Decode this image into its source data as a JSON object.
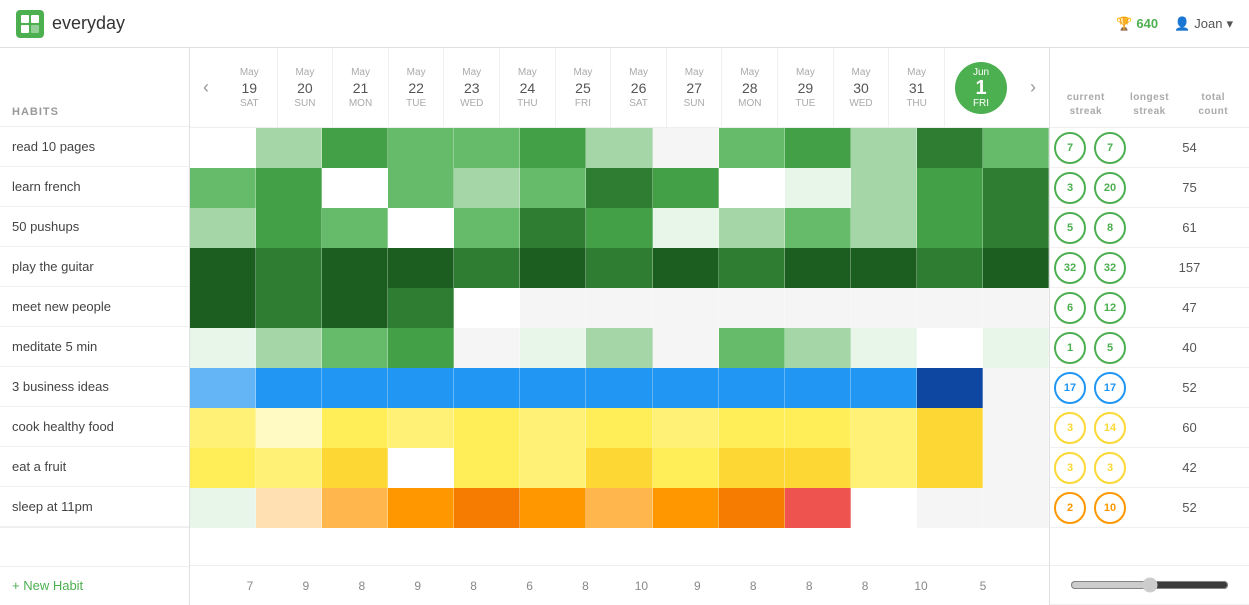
{
  "app": {
    "name": "everyday",
    "score": "640",
    "user": "Joan"
  },
  "header": {
    "habits_label": "HABITS",
    "nav_prev": "‹",
    "nav_next": "›",
    "today": {
      "month": "Jun",
      "day": "1",
      "dow": "FRI"
    }
  },
  "days": [
    {
      "month": "May",
      "num": "19",
      "dow": "SAT"
    },
    {
      "month": "May",
      "num": "20",
      "dow": "SUN"
    },
    {
      "month": "May",
      "num": "21",
      "dow": "MON"
    },
    {
      "month": "May",
      "num": "22",
      "dow": "TUE"
    },
    {
      "month": "May",
      "num": "23",
      "dow": "WED"
    },
    {
      "month": "May",
      "num": "24",
      "dow": "THU"
    },
    {
      "month": "May",
      "num": "25",
      "dow": "FRI"
    },
    {
      "month": "May",
      "num": "26",
      "dow": "SAT"
    },
    {
      "month": "May",
      "num": "27",
      "dow": "SUN"
    },
    {
      "month": "May",
      "num": "28",
      "dow": "MON"
    },
    {
      "month": "May",
      "num": "29",
      "dow": "TUE"
    },
    {
      "month": "May",
      "num": "30",
      "dow": "WED"
    },
    {
      "month": "May",
      "num": "31",
      "dow": "THU"
    }
  ],
  "habits": [
    {
      "name": "read 10 pages",
      "color": "green",
      "current": 7,
      "longest": 7,
      "total": 54,
      "cells": [
        "gw",
        "g2",
        "g4",
        "g3",
        "g3",
        "g4",
        "g2",
        "g0",
        "g3",
        "g4",
        "g2",
        "g5",
        "g3"
      ]
    },
    {
      "name": "learn french",
      "color": "green",
      "current": 3,
      "longest": 20,
      "total": 75,
      "cells": [
        "g3",
        "g4",
        "gw",
        "g3",
        "g2",
        "g3",
        "g5",
        "g4",
        "gw",
        "g1",
        "g2",
        "g4",
        "g5"
      ]
    },
    {
      "name": "50 pushups",
      "color": "green",
      "current": 5,
      "longest": 8,
      "total": 61,
      "cells": [
        "g2",
        "g4",
        "g3",
        "gw",
        "g3",
        "g5",
        "g4",
        "g1",
        "g2",
        "g3",
        "g2",
        "g4",
        "g5"
      ]
    },
    {
      "name": "play the guitar",
      "color": "green",
      "current": 32,
      "longest": 32,
      "total": 157,
      "cells": [
        "g6",
        "g5",
        "g6",
        "g6",
        "g5",
        "g6",
        "g5",
        "g6",
        "g5",
        "g6",
        "g6",
        "g5",
        "g6"
      ]
    },
    {
      "name": "meet new people",
      "color": "green",
      "current": 6,
      "longest": 12,
      "total": 47,
      "cells": [
        "g6",
        "g5",
        "g6",
        "g5",
        "gw",
        "g0",
        "g0",
        "g0",
        "g0",
        "g0",
        "g0",
        "g0",
        "g0"
      ]
    },
    {
      "name": "meditate 5 min",
      "color": "green",
      "current": 1,
      "longest": 5,
      "total": 40,
      "cells": [
        "g1",
        "g2",
        "g3",
        "g4",
        "g0",
        "g1",
        "g2",
        "g0",
        "g3",
        "g2",
        "g1",
        "gw",
        "g1"
      ]
    },
    {
      "name": "3 business ideas",
      "color": "blue",
      "current": 17,
      "longest": 17,
      "total": 52,
      "cells": [
        "b2",
        "b3",
        "b3",
        "b3",
        "b3",
        "b3",
        "b3",
        "b3",
        "b3",
        "b3",
        "b3",
        "b5",
        "g0"
      ]
    },
    {
      "name": "cook healthy food",
      "color": "yellow",
      "current": 3,
      "longest": 14,
      "total": 60,
      "cells": [
        "y2",
        "y1",
        "y3",
        "y2",
        "y3",
        "y2",
        "y3",
        "y2",
        "y3",
        "y3",
        "y2",
        "y4",
        "g0"
      ]
    },
    {
      "name": "eat a fruit",
      "color": "yellow",
      "current": 3,
      "longest": 3,
      "total": 42,
      "cells": [
        "y3",
        "y2",
        "y4",
        "gw",
        "y3",
        "y2",
        "y4",
        "y3",
        "y4",
        "y4",
        "y2",
        "y4",
        "g0"
      ]
    },
    {
      "name": "sleep at 11pm",
      "color": "orange",
      "current": 2,
      "longest": 10,
      "total": 52,
      "cells": [
        "g1",
        "o1",
        "o2",
        "o3",
        "o4",
        "o3",
        "o2",
        "o3",
        "o4",
        "r1",
        "gw",
        "g0",
        "g0"
      ]
    }
  ],
  "stats_header": {
    "current_streak": "current\nstreak",
    "longest_streak": "longest\nstreak",
    "total_count": "total\ncount"
  },
  "col_counts": [
    "7",
    "9",
    "8",
    "9",
    "8",
    "6",
    "8",
    "10",
    "9",
    "8",
    "8",
    "8",
    "10"
  ],
  "footer_count": "5",
  "new_habit_label": "+ New Habit"
}
